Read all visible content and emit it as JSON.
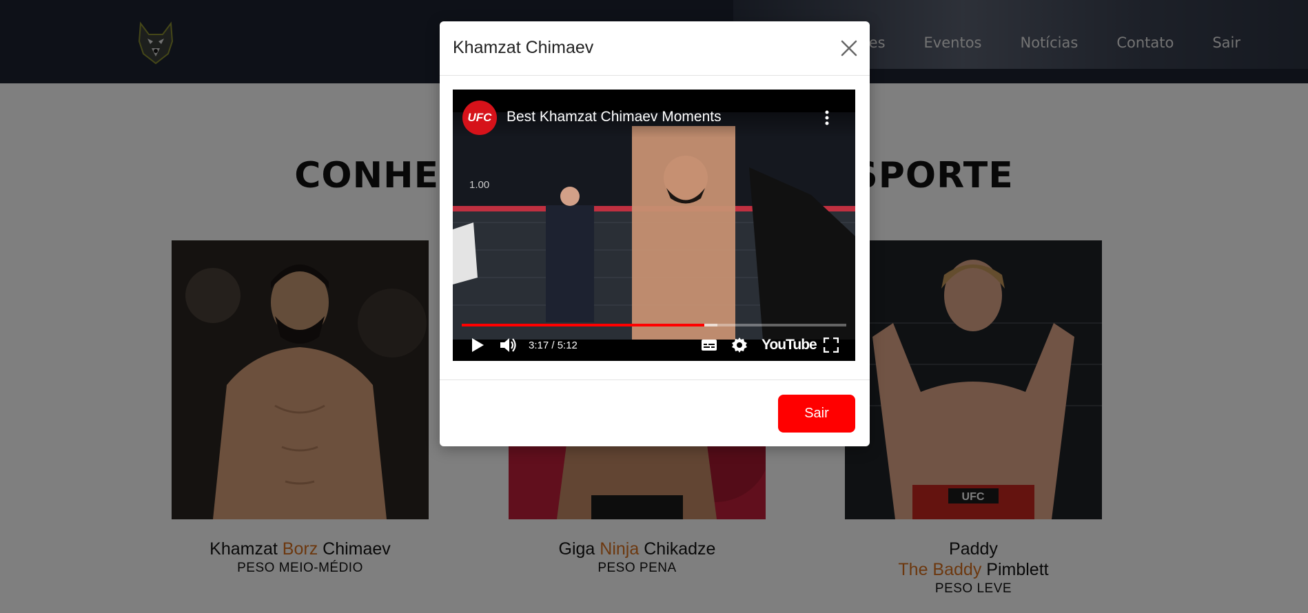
{
  "nav": {
    "items": [
      {
        "label": "ores"
      },
      {
        "label": "Eventos"
      },
      {
        "label": "Notícias"
      },
      {
        "label": "Contato"
      },
      {
        "label": "Sair"
      }
    ]
  },
  "section": {
    "title_left": "CONHEÇ",
    "title_right": "SPORTE"
  },
  "fighters": [
    {
      "first": "Khamzat",
      "nick": "Borz",
      "last": "Chimaev",
      "weight": "PESO MEIO-MÉDIO"
    },
    {
      "first": "Giga",
      "nick": "Ninja",
      "last": "Chikadze",
      "weight": "PESO PENA"
    },
    {
      "first": "Paddy",
      "nick": "The Baddy",
      "last": "Pimblett",
      "weight": "PESO LEVE"
    }
  ],
  "modal": {
    "title": "Khamzat Chimaev",
    "footer_button": "Sair",
    "video": {
      "channel_logo_text": "UFC",
      "title": "Best Khamzat Chimaev Moments",
      "zoom_readout": "1.00",
      "time": "3:17 / 5:12",
      "played_fraction": 0.631,
      "buffered_fraction": 0.665,
      "brand": "YouTube"
    }
  },
  "colors": {
    "accent_nick": "#d9701e",
    "navbar_bg": "#1c2330",
    "button_red": "#ff0000"
  }
}
